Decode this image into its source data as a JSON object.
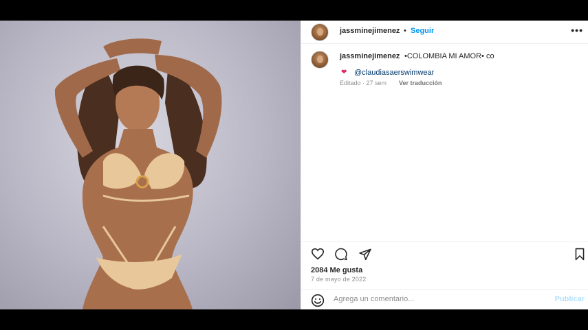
{
  "post": {
    "username": "jassminejimenez",
    "separator": "•",
    "follow_label": "Seguir",
    "more_label": "•••",
    "caption": "•COLOMBIA MI AMOR• co",
    "mention_emoji": "❤",
    "mention": "@claudiasaerswimwear",
    "edited": "Editado · 27 sem",
    "translate_label": "Ver traducción",
    "likes": "2084 Me gusta",
    "date": "7 de mayo de 2022",
    "comment_placeholder": "Agrega un comentario...",
    "publish_label": "Publicar"
  },
  "icons": {
    "like": "heart-icon",
    "comment": "comment-icon",
    "share": "send-icon",
    "save": "bookmark-icon",
    "emoji": "emoji-icon"
  },
  "colors": {
    "link": "#0095f6",
    "publish_disabled": "#b2dffc",
    "secondary_text": "#8e8e8e"
  }
}
